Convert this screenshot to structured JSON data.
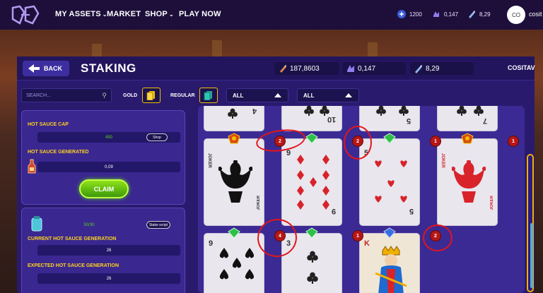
{
  "nav": {
    "items": [
      {
        "label": "MY ASSETS",
        "has_chevron": true
      },
      {
        "label": "MARKET",
        "has_chevron": false
      },
      {
        "label": "SHOP",
        "has_chevron": true
      },
      {
        "label": "PLAY NOW",
        "has_chevron": false
      }
    ],
    "stats": [
      {
        "icon": "star-token-icon",
        "value": "1200"
      },
      {
        "icon": "crystal-icon",
        "value": "0,147"
      },
      {
        "icon": "hot-sauce-icon",
        "value": "8,29"
      }
    ],
    "avatar_initials": "CO",
    "username": "cosit"
  },
  "header": {
    "back_label": "BACK",
    "title": "STAKING",
    "stats": [
      {
        "icon": "hot-sauce-bottle-icon",
        "value": "187,8603"
      },
      {
        "icon": "crystal-icon",
        "value": "0,147"
      },
      {
        "icon": "hot-sauce-icon",
        "value": "8,29"
      }
    ],
    "username": "COSITAV"
  },
  "filters": {
    "search_placeholder": "SEARCH...",
    "gold_label": "GOLD",
    "regular_label": "REGULAR",
    "select_1": "ALL",
    "select_2": "ALL"
  },
  "side": {
    "cap_label": "HOT SAUCE CAP",
    "cap_value": "450",
    "shop_label": "Shop",
    "generated_label": "HOT SAUCE GENERATED",
    "generated_value": "0,09",
    "claim_label": "CLAIM",
    "stake_progress": "50/30",
    "stake_button": "Stake script",
    "current_label": "CURRENT HOT SAUCE GENERATION",
    "current_value": "26",
    "expected_label": "EXPECTED HOT SAUCE GENERATION",
    "expected_value": "26"
  },
  "cards": {
    "row0": [
      {
        "rank": "4",
        "suit": "club"
      },
      {
        "rank": "10",
        "suit": "club"
      },
      {
        "rank": "5",
        "suit": "club"
      },
      {
        "rank": "7",
        "suit": "club"
      }
    ],
    "row1": [
      {
        "rank": "JOKER",
        "suit": "joker-black",
        "level": "2",
        "gem": "crest"
      },
      {
        "rank": "9",
        "suit": "diamond",
        "level": "2",
        "gem": "green"
      },
      {
        "rank": "5",
        "suit": "heart",
        "level": "1",
        "gem": "green"
      },
      {
        "rank": "JOKER",
        "suit": "joker-red",
        "level": "1",
        "gem": "crest"
      }
    ],
    "row2": [
      {
        "rank": "9",
        "suit": "spade",
        "level": "4",
        "gem": "green"
      },
      {
        "rank": "3",
        "suit": "club",
        "level": "1",
        "gem": "green"
      },
      {
        "rank": "K",
        "suit": "king",
        "level": "2",
        "gem": "blue"
      }
    ]
  },
  "colors": {
    "accent_yellow": "#ffd21e",
    "level_badge": "#b81616",
    "annotation_red": "#e3151a",
    "claim_green": "#5cc01a"
  }
}
